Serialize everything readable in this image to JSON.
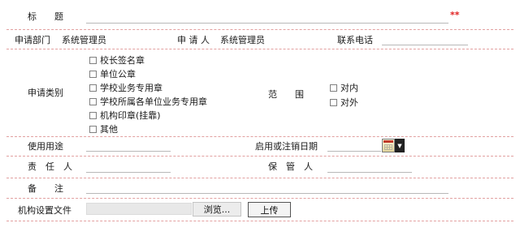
{
  "form": {
    "title": {
      "label": "标　　题",
      "required_mark": "**"
    },
    "department": {
      "label": "申请部门",
      "value": "系统管理员"
    },
    "applicant": {
      "label": "申 请 人",
      "value": "系统管理员"
    },
    "phone": {
      "label": "联系电话",
      "value": ""
    },
    "category": {
      "label": "申请类别",
      "options": [
        "校长签名章",
        "单位公章",
        "学校业务专用章",
        "学校所属各单位业务专用章",
        "机构印章(挂靠)",
        "其他"
      ]
    },
    "scope": {
      "label": "范　　围",
      "options": [
        "对内",
        "对外"
      ]
    },
    "usage": {
      "label": "使用用途",
      "value": ""
    },
    "date": {
      "label": "启用或注销日期",
      "value": ""
    },
    "responsible": {
      "label": "责　任　人",
      "value": ""
    },
    "custodian": {
      "label": "保　管　人",
      "value": ""
    },
    "remarks": {
      "label": "备　　注",
      "value": ""
    },
    "file": {
      "label": "机构设置文件",
      "browse_label": "浏览...",
      "upload_label": "上传"
    }
  },
  "colors": {
    "separator": "#e2a0a0",
    "required": "#e02020",
    "field_line": "#b8b8b8"
  }
}
